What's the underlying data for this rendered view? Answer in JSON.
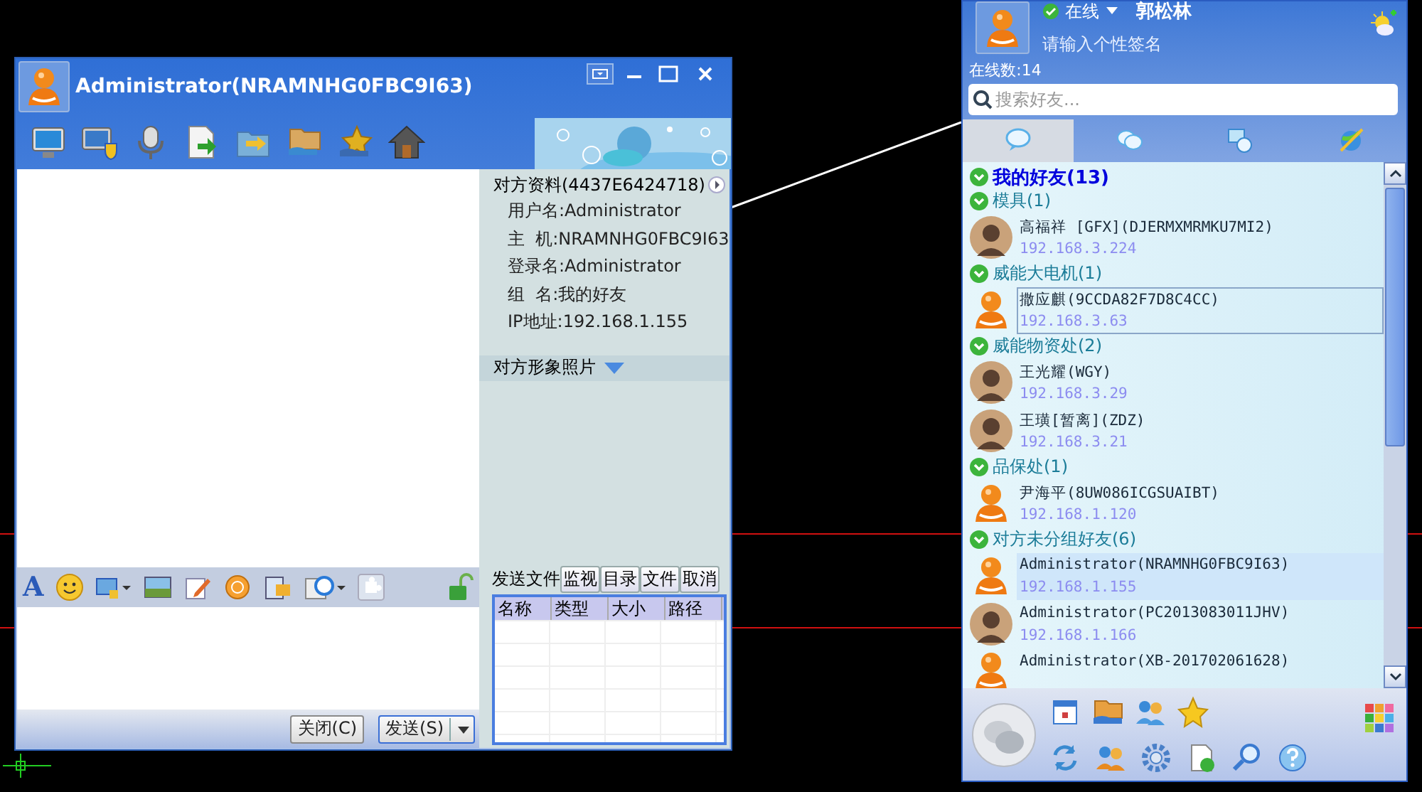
{
  "chat_window": {
    "title": "Administrator(NRAMNHG0FBC9I63)",
    "info_panel": {
      "heading": "对方资料(4437E6424718)",
      "fields": [
        "用户名:Administrator",
        "主  机:NRAMNHG0FBC9I63",
        "登录名:Administrator",
        "组  名:我的好友",
        "IP地址:192.168.1.155"
      ],
      "photo_heading": "对方形象照片"
    },
    "format_toolbar": {
      "font_button": "A"
    },
    "file_panel": {
      "label": "发送文件",
      "buttons": [
        "监视",
        "目录",
        "文件",
        "取消"
      ],
      "columns": [
        "名称",
        "类型",
        "大小",
        "路径"
      ]
    },
    "buttons": [
      {
        "label": "关闭(C)",
        "kind": "plain"
      },
      {
        "label": "发送(S)",
        "kind": "split"
      }
    ]
  },
  "friend_window": {
    "status": "在线",
    "user_name": "郭松林",
    "signature": "请输入个性签名",
    "online_count": "在线数:14",
    "search": {
      "placeholder": "搜索好友..."
    },
    "tabs": [
      {
        "selected": true
      },
      {
        "selected": false
      },
      {
        "selected": false
      },
      {
        "selected": false
      }
    ],
    "friends": {
      "label": "我的好友(13)",
      "expanded": true,
      "children": [
        {
          "label": "模具(1)",
          "expanded": true,
          "children": [
            {
              "name": "高福祥 [GFX](DJERMXMRMKU7MI2)",
              "ip": "192.168.3.224",
              "kind": "custom",
              "selected": false,
              "hovered": false
            }
          ]
        },
        {
          "label": "威能大电机(1)",
          "expanded": true,
          "children": [
            {
              "name": "撒应麒(9CCDA82F7D8C4CC)",
              "ip": "192.168.3.63",
              "kind": "default",
              "selected": false,
              "hovered": true
            }
          ]
        },
        {
          "label": "威能物资处(2)",
          "expanded": true,
          "children": [
            {
              "name": "王光耀(WGY)",
              "ip": "192.168.3.29",
              "kind": "custom",
              "selected": false,
              "hovered": false
            },
            {
              "name": "王璜[暂离](ZDZ)",
              "ip": "192.168.3.21",
              "kind": "custom",
              "selected": false,
              "hovered": false
            }
          ]
        },
        {
          "label": "品保处(1)",
          "expanded": true,
          "children": [
            {
              "name": "尹海平(8UW086ICGSUAIBT)",
              "ip": "192.168.1.120",
              "kind": "default",
              "selected": false,
              "hovered": false
            }
          ]
        },
        {
          "label": "对方未分组好友(6)",
          "expanded": true,
          "children": [
            {
              "name": "Administrator(NRAMNHG0FBC9I63)",
              "ip": "192.168.1.155",
              "kind": "default",
              "selected": true,
              "hovered": false
            },
            {
              "name": "Administrator(PC2013083011JHV)",
              "ip": "192.168.1.166",
              "kind": "custom",
              "selected": false,
              "hovered": false
            },
            {
              "name": "Administrator(XB-201702061628)",
              "kind": "default",
              "selected": false,
              "hovered": false
            }
          ]
        }
      ]
    }
  }
}
